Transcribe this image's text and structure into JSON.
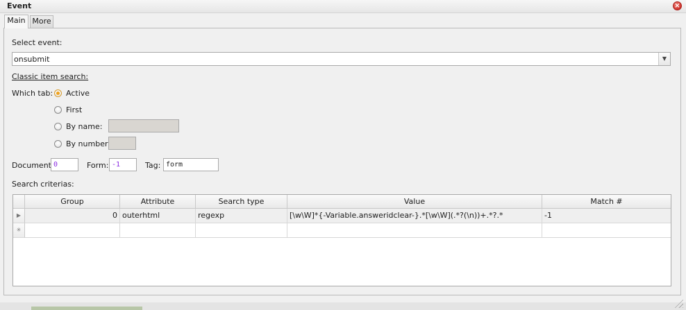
{
  "window": {
    "title": "Event",
    "close_icon": "close-icon"
  },
  "tabs": [
    {
      "label": "Main"
    },
    {
      "label": "More"
    }
  ],
  "select_event": {
    "label": "Select event:",
    "value": "onsubmit"
  },
  "classic_search": {
    "label": "Classic item search:"
  },
  "which_tab": {
    "label": "Which tab:",
    "options": [
      {
        "label": "Active",
        "checked": true
      },
      {
        "label": "First",
        "checked": false
      },
      {
        "label": "By name:",
        "checked": false
      },
      {
        "label": "By number:",
        "checked": false
      }
    ]
  },
  "fields": {
    "document_label": "Document:",
    "document_value": "0",
    "form_label": "Form:",
    "form_value": "-1",
    "tag_label": "Tag:",
    "tag_value": "form"
  },
  "criteria": {
    "label": "Search criterias:",
    "columns": [
      "Group",
      "Attribute",
      "Search type",
      "Value",
      "Match #"
    ],
    "rows": [
      {
        "group": "0",
        "attribute": "outerhtml",
        "search_type": "regexp",
        "value": "[\\w\\W]*{-Variable.answeridclear-}.*[\\w\\W](.*?(\\n))+.*?.*",
        "match": "-1"
      }
    ]
  }
}
